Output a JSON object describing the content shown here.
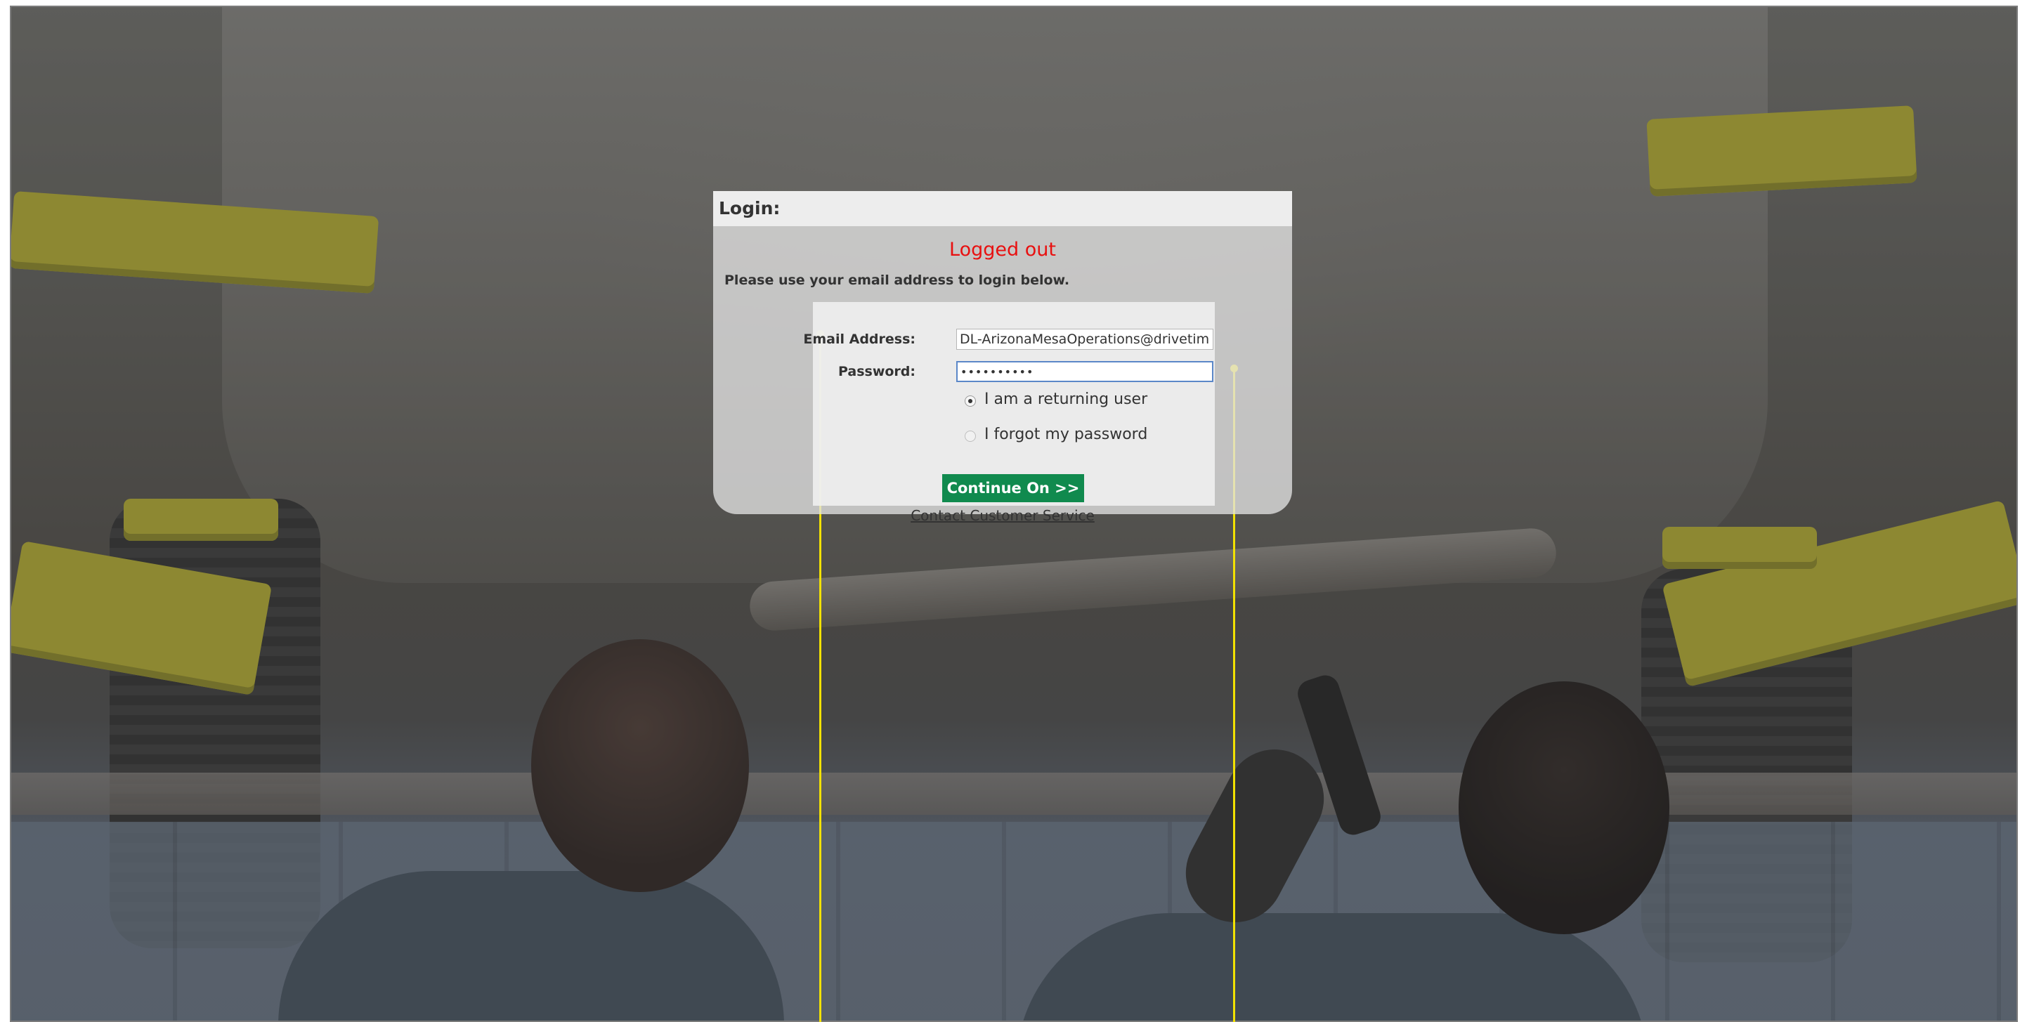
{
  "login": {
    "header_title": "Login:",
    "status_message": "Logged out",
    "status_color": "#e81010",
    "instructions": "Please use your email address to login below.",
    "email_label": "Email Address:",
    "email_value": "DL-ArizonaMesaOperations@drivetime.c",
    "password_label": "Password:",
    "password_value": "••••••••••",
    "radio_returning_label": "I am a returning user",
    "radio_forgot_label": "I forgot my password",
    "returning_selected": true,
    "continue_label": "Continue On >>",
    "continue_color": "#108a4e",
    "contact_link": "Contact Customer Service"
  },
  "background": {
    "scene": "garage-undercar-inspection-photo"
  }
}
